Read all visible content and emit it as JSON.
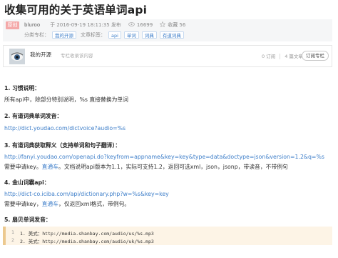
{
  "article": {
    "title": "收集可用的关于英语单词api",
    "badge": "原创",
    "author": "bluroo",
    "date": "于 2016-09-19 18:11:35 发布",
    "views": "16699",
    "favorites": "收藏 56",
    "column_label": "分类专栏：",
    "column_tag": "我的开源",
    "tags_label": "文章标签：",
    "tags": [
      "api",
      "单词",
      "词典",
      "有道词典"
    ]
  },
  "column_card": {
    "name": "我的开源",
    "desc": "专栏收录该内容",
    "subscriptions": "0 订阅",
    "articles": "4 篇文章",
    "subscribe_label": "订阅专栏"
  },
  "content": {
    "s1_title": "1. 习惯说明：",
    "s1_text": "所有api中，除部分特别说明，%s 直接替换为单词",
    "s2_title": "2. 有道词典单词发音：",
    "s2_link": "http://dict.youdao.com/dictvoice?audio=%s",
    "s3_title": "3. 有道词典获取释义（支持单词和句子翻译）：",
    "s3_link": "http://fanyi.youdao.com/openapi.do?keyfrom=appname&key=key&type=data&doctype=json&version=1.2&q=%s",
    "s3_text_a": "需要申请key。",
    "s3_text_link": "直通车",
    "s3_text_b": "。文档说明api版本为1.1，实际可支持1.2，返回可选xml，json，jsonp，带读音，不带例句",
    "s4_title": "4. 金山词霸api：",
    "s4_link": "http://dict-co.iciba.com/api/dictionary.php?w=%s&key=key",
    "s4_text_a": "需要申请key，",
    "s4_text_link": "直通车",
    "s4_text_b": "，仅返回xml格式，带例句。",
    "s5_title": "5. 扇贝单词发音：",
    "code": [
      {
        "num": "1",
        "text": "1. 美式：http://media.shanbay.com/audio/us/%s.mp3"
      },
      {
        "num": "2",
        "text": "2. 英式：http://media.shanbay.com/audio/uk/%s.mp3"
      }
    ]
  },
  "colors": {
    "link": "#3d7ec9",
    "badge": "#f4a9a9",
    "code_bg": "#fdf4e6",
    "code_border": "#ecc98f"
  },
  "icons": [
    "eye-icon",
    "star-icon"
  ]
}
